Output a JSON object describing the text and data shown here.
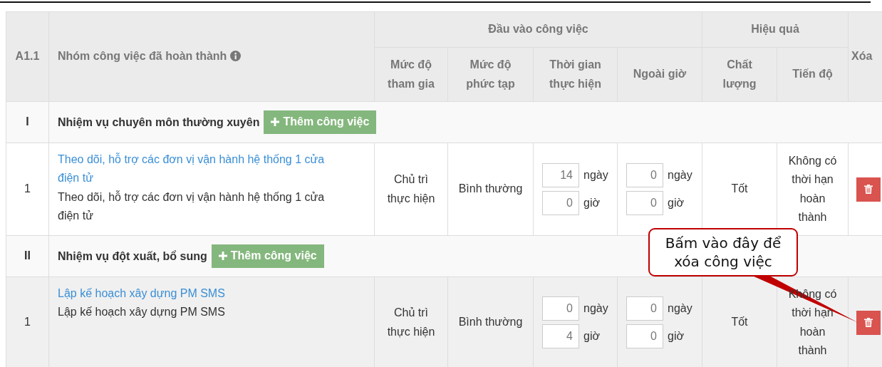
{
  "header": {
    "code": "A1.1",
    "title": "Nhóm công việc đã hoàn thành",
    "groups": [
      {
        "label": "Đầu vào công việc",
        "columns": [
          "Mức độ tham gia",
          "Mức độ phức tạp",
          "Thời gian thực hiện",
          "Ngoài giờ"
        ]
      },
      {
        "label": "Hiệu quả",
        "columns": [
          "Chất lượng",
          "Tiến độ"
        ]
      }
    ],
    "delete": "Xóa"
  },
  "sections": [
    {
      "code": "I",
      "title": "Nhiệm vụ chuyên môn thường xuyên",
      "add_button": "Thêm công việc",
      "rows": [
        {
          "index": "1",
          "link": "Theo dõi, hỗ trợ các đơn vị vận hành hệ thống 1 cửa điện tử",
          "description": "Theo dõi, hỗ trợ các đơn vị vận hành hệ thống 1 cửa điện tử",
          "participation": "Chủ trì thực hiện",
          "complexity": "Bình thường",
          "time": {
            "days": "14",
            "day_unit": "ngày",
            "hours": "0",
            "hour_unit": "giờ"
          },
          "overtime": {
            "days": "0",
            "day_unit": "ngày",
            "hours": "0",
            "hour_unit": "giờ"
          },
          "quality": "Tốt",
          "progress": "Không có thời hạn hoàn thành",
          "highlighted": false
        }
      ]
    },
    {
      "code": "II",
      "title": "Nhiệm vụ đột xuất, bổ sung",
      "add_button": "Thêm công việc",
      "rows": [
        {
          "index": "1",
          "link": "Lập kế hoạch xây dựng PM SMS",
          "description": "Lập kế hoạch xây dựng PM SMS",
          "participation": "Chủ trì thực hiện",
          "complexity": "Bình thường",
          "time": {
            "days": "0",
            "day_unit": "ngày",
            "hours": "4",
            "hour_unit": "giờ"
          },
          "overtime": {
            "days": "0",
            "day_unit": "ngày",
            "hours": "0",
            "hour_unit": "giờ"
          },
          "quality": "Tốt",
          "progress": "Không có thời hạn hoàn thành",
          "highlighted": true
        }
      ]
    }
  ],
  "callout": {
    "text": "Bấm vào đây để xóa công việc"
  }
}
